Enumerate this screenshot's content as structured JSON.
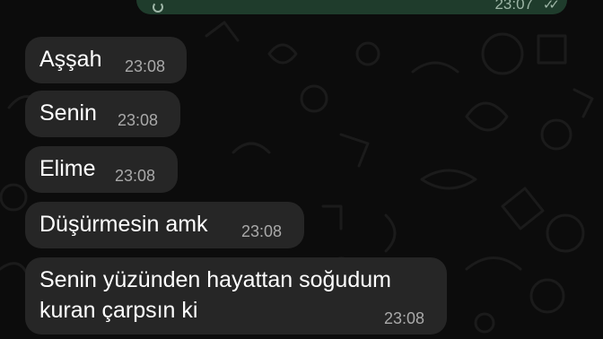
{
  "colors": {
    "background": "#0c0c0c",
    "incoming_bubble": "#262626",
    "outgoing_bubble": "#1f3c2c",
    "message_text": "#ffffff",
    "timestamp_text": "#a9a9a9"
  },
  "outgoing_partial": {
    "time": "23:07",
    "status_icon": "double-check-icon"
  },
  "messages": [
    {
      "text": "Aşşah",
      "time": "23:08"
    },
    {
      "text": "Senin",
      "time": "23:08"
    },
    {
      "text": "Elime",
      "time": "23:08"
    },
    {
      "text": "Düşürmesin amk",
      "time": "23:08"
    },
    {
      "text": "Senin yüzünden hayattan soğudum\nkuran çarpsın ki",
      "time": "23:08"
    }
  ]
}
